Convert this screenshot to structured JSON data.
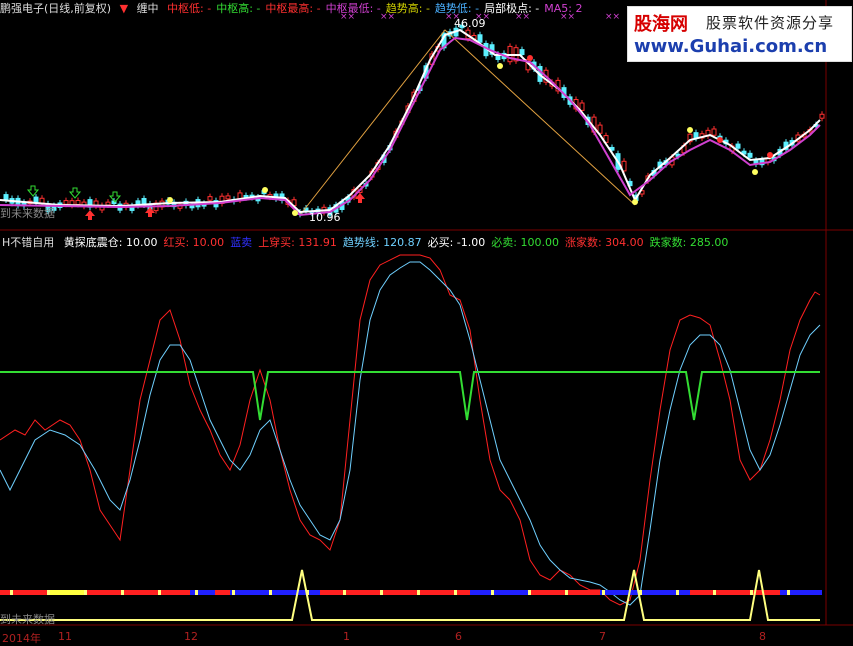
{
  "top_header": {
    "stock_name": "鹏强电子(日线,前复权)",
    "chan_label": "缠中",
    "items": [
      {
        "label": "中枢低: -",
        "color": "#ff3030"
      },
      {
        "label": "中枢高: -",
        "color": "#33dd33"
      },
      {
        "label": "中枢最高: -",
        "color": "#ff3030"
      },
      {
        "label": "中枢最低: -",
        "color": "#d040d0"
      },
      {
        "label": "趋势高: -",
        "color": "#d0d000"
      },
      {
        "label": "趋势低: -",
        "color": "#4ab0ff"
      },
      {
        "label": "局部极点: -",
        "color": "#ffffff"
      },
      {
        "label": "MA5: 2",
        "color": "#d040d0"
      }
    ]
  },
  "logo": {
    "brand": "股海网",
    "slogan": "股票软件资源分享",
    "url": "www.Guhai.com.cn"
  },
  "price_panel": {
    "high_label": "46.09",
    "low_label": "10.96",
    "future_label": "到未来数据"
  },
  "indicator_header": {
    "name": "H不错自用",
    "items": [
      {
        "label": "黄探底震仓: 10.00",
        "color": "#ffffff"
      },
      {
        "label": "红买: 10.00",
        "color": "#ff3030"
      },
      {
        "label": "蓝卖",
        "color": "#3030ff"
      },
      {
        "label": "上穿买: 131.91",
        "color": "#ff3030"
      },
      {
        "label": "趋势线: 120.87",
        "color": "#6fd0ff"
      },
      {
        "label": "必买: -1.00",
        "color": "#ffffff"
      },
      {
        "label": "必卖: 100.00",
        "color": "#33dd33"
      },
      {
        "label": "涨家数: 304.00",
        "color": "#ff3030"
      },
      {
        "label": "跌家数: 285.00",
        "color": "#33dd33"
      }
    ]
  },
  "bottom_panel": {
    "future_label": "到未来数据"
  },
  "x_axis": {
    "year_label": "2014年",
    "months": [
      "11",
      "12",
      "1",
      "6",
      "7",
      "8"
    ]
  },
  "colors": {
    "up": "#ff3030",
    "down": "#5cf0ff",
    "ma": "#d040d0",
    "trend": "#ffffff",
    "red_line": "#ff2020",
    "cyan_line": "#6fd0ff",
    "green_line": "#33dd33",
    "yellow_line": "#ffff80"
  }
}
